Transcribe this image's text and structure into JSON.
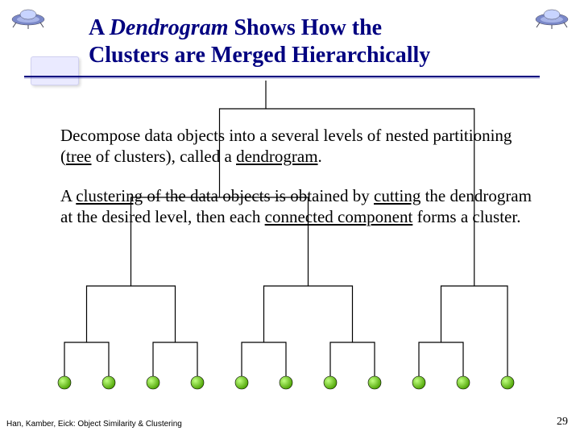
{
  "title": {
    "line1_prefix": "A ",
    "line1_emph": "Dendrogram",
    "line1_suffix": " Shows How the",
    "line2": "Clusters are Merged Hierarchically"
  },
  "body": {
    "p1_a": "Decompose data objects into a several levels of nested partitioning (",
    "p1_tree": "tree",
    "p1_b": " of clusters), called a ",
    "p1_dendro": "dendrogram",
    "p1_c": ".",
    "p2_a": "A ",
    "p2_clustering": "clustering",
    "p2_b": " of the data objects is obtained by ",
    "p2_cutting": "cutting",
    "p2_c": " the dendrogram at the desired level, then each ",
    "p2_connected": "connected component",
    "p2_d": " forms a cluster."
  },
  "footer": {
    "left": "Han, Kamber, Eick: Object Similarity & Clustering",
    "pageno": "29"
  }
}
